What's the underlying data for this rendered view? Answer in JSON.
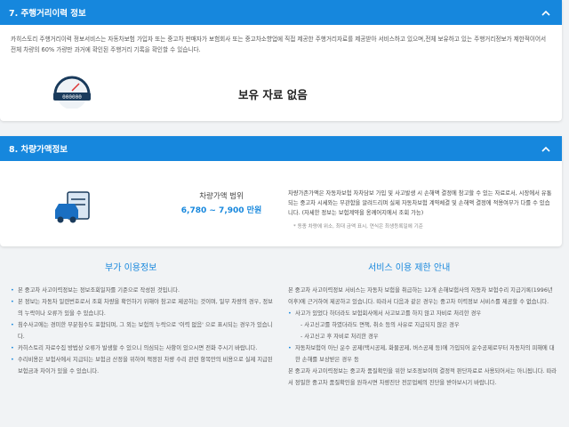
{
  "section7": {
    "title": "7. 주행거리이력 정보",
    "desc": "카히스토리 주행거리이력 정보서비스는 자동차보험 가입자 또는 중고차 판매자가 보험회사 또는 중고차소향업에 직접 제공한 주행거리자료를 제공받아 서비스하고 있으며,전체 보유하고 있는 주행거리정보가 제한적이어서 전체 차량의 60% 가량만 과거에 확인된 주행거리 기록을 확인할 수 있습니다.",
    "empty_text": "보유 자료 없음",
    "icon": "odometer-icon"
  },
  "section8": {
    "title": "8. 차량가액정보",
    "price_label": "차량가액 범위",
    "price_value": "6,780 ~ 7,900 만원",
    "icon": "car-value-icon",
    "desc": "차량가존가액은 자동차보험 자차담보 가입 및 사고발생 시 손해액 결정에 참고할 수 있는 자료로서, 시장에서 유통되는 중고차 시세와는 무관함을 알려드리며 실제 자동차보험 계약체결 및 손해액 결정에 적용여부가 다를 수 있습니다. (자세한 정보는 보험계약을 옹께어지에서 조회 가능)",
    "note": "* 동종 차량에 위소, 최대 금액 표시, 연식은 최생등록일에 기준"
  },
  "info": {
    "title": "부가 이용정보",
    "items": [
      "본 중고차 사고이력정보는 정보조회일자를 기준으로 작성된 것입니다.",
      "본 정보는 자동차 일련번호로서 조회 차량을 확인하기 위해야 참고로 제공하는 것이며, 일부 차량의 경우, 정보의 누락이나 오류가 있을 수 있습니다.",
      "침수사고에는 경미한 부분침수도 포함되며, 그 외는 보험의 누락으로 '이력 없음' 으로 표시되는 경우가 있습니다.",
      "카히스토리 자료수집 방법상 오류가 발생할 수 있으니 의심되는 사항이 있으시면 전화 주시기 바랍니다.",
      "수리비용은 보험사에서 지급되는 보험금 산정을 위하여 책정된 차량 수리 관련 항목만의 비용으로 실제 지급된 보험금과 차이가 있을 수 있습니다."
    ]
  },
  "limits": {
    "title": "서비스 이용 제한 안내",
    "intro": "본 중고차 사고이력정보 서비스는 자동차 보험을 취급하는 12개 손해보험사의 자동차 보험수리 지급기록(1996년 이후)에 근거하여 제공하고 있습니다. 따라서 다음과 같은 경우는 중고차 이력정보 서비스를 제공할 수 없습니다.",
    "items": [
      "사고가 있었다 하더라도 보험회사에서 사고보고를 하지 않고 자비로 처리한 경우",
      "자동차보험이 아닌 운수 공제(택시공제, 화물공제, 버스공제 등)에 가입되어 운수공제로부터 자동차의 피해에 대한 손해를 보상받은 경우 등"
    ],
    "subs": [
      "- 사고신고를 하였더라도 면책, 취소 등의 사유로 지급되지 않은 경우",
      "- 사고신고 후 자비로 처리한 경우"
    ],
    "outro": "본 중고차 사고이력정보는 중고차 품질확인을 위한 보조정보이며 결정적 판단자료로 사용되어서는 아니됩니다. 따라서 정밀한 중고차 품질확인을 원하시면 차량진단 전문업체의 진단을 받아보시기 바랍니다."
  }
}
